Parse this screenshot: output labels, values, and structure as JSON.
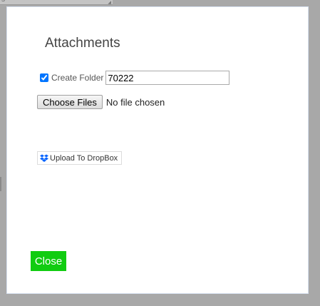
{
  "dialog": {
    "title": "Attachments",
    "create_folder": {
      "checked": true,
      "label": "Create Folder",
      "value": "70222"
    },
    "file_picker": {
      "button_label": "Choose Files",
      "status_text": "No file chosen"
    },
    "dropbox_button_label": "Upload To DropBox",
    "close_label": "Close"
  },
  "colors": {
    "backdrop": "#a8a8a8",
    "close_button": "#11cc11",
    "dropbox_blue": "#0061fe"
  }
}
